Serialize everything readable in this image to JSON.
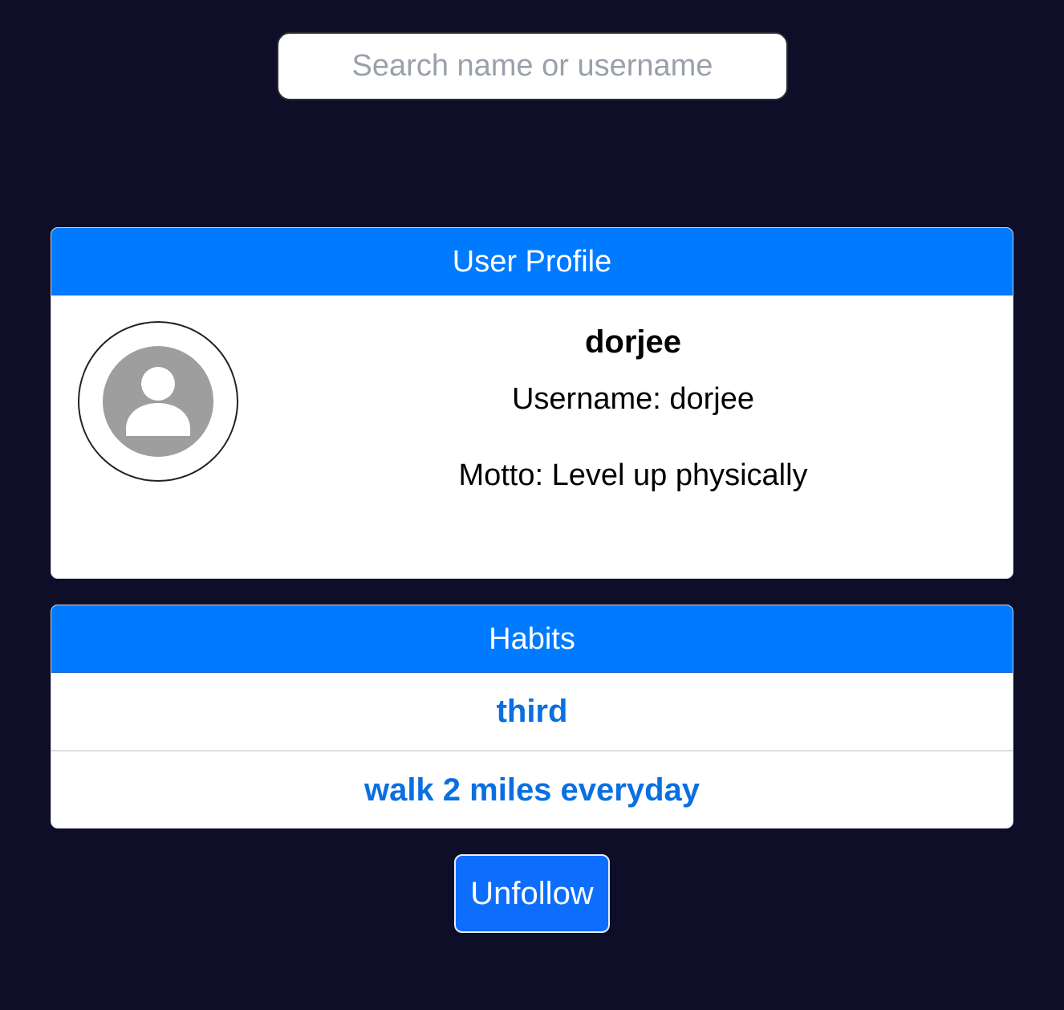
{
  "search": {
    "placeholder": "Search name or username",
    "value": ""
  },
  "profile": {
    "header": "User Profile",
    "avatar_icon": "user-placeholder-icon",
    "display_name": "dorjee",
    "username_text": "Username: dorjee",
    "motto_text": "Motto: Level up physically"
  },
  "habits": {
    "header": "Habits",
    "items": [
      {
        "label": "third"
      },
      {
        "label": "walk 2 miles everyday"
      }
    ]
  },
  "actions": {
    "unfollow_label": "Unfollow"
  },
  "colors": {
    "background": "#0e0e28",
    "header_blue": "#007bff",
    "link_blue": "#0a6fe0",
    "button_blue": "#0d6efd",
    "avatar_gray": "#9e9e9e"
  }
}
